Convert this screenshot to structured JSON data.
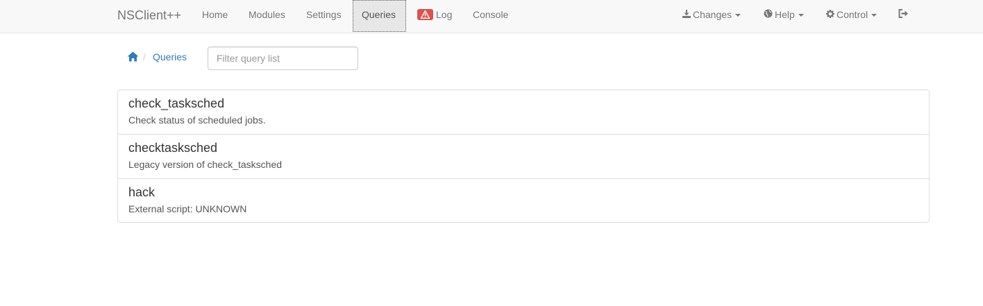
{
  "navbar": {
    "brand": "NSClient++",
    "items": [
      {
        "label": "Home"
      },
      {
        "label": "Modules"
      },
      {
        "label": "Settings"
      },
      {
        "label": "Queries"
      },
      {
        "label": "Log"
      },
      {
        "label": "Console"
      }
    ],
    "right": [
      {
        "label": "Changes"
      },
      {
        "label": "Help"
      },
      {
        "label": "Control"
      }
    ]
  },
  "breadcrumb": {
    "current": "Queries"
  },
  "filter": {
    "placeholder": "Filter query list"
  },
  "queries": [
    {
      "name": "check_tasksched",
      "description": "Check status of scheduled jobs."
    },
    {
      "name": "checktasksched",
      "description": "Legacy version of check_tasksched"
    },
    {
      "name": "hack",
      "description": "External script: UNKNOWN"
    }
  ],
  "colors": {
    "accent": "#337ab7",
    "danger": "#d9534f",
    "navbar_bg": "#f8f8f8"
  }
}
